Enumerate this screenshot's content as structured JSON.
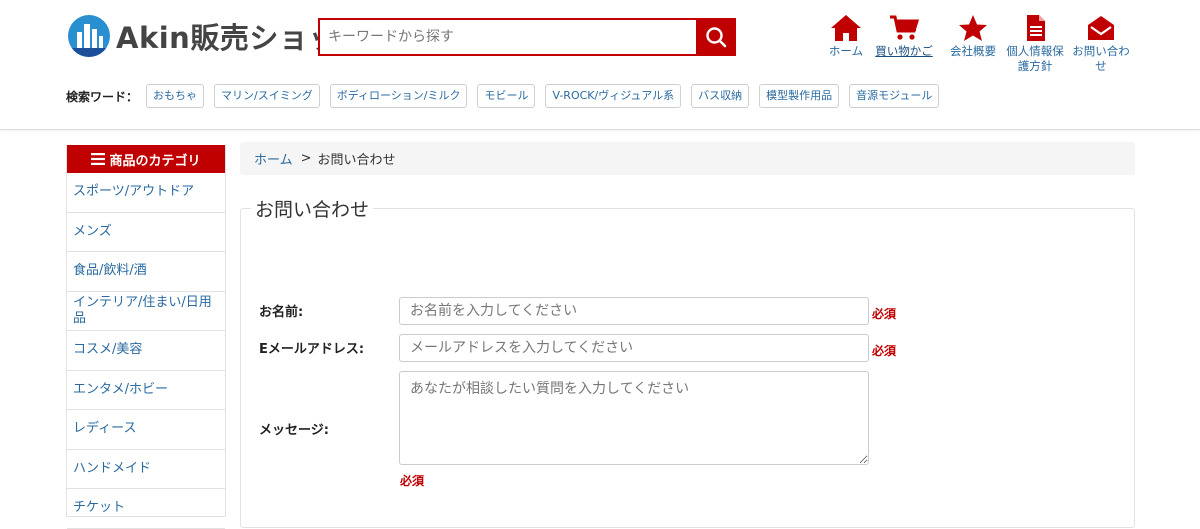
{
  "header": {
    "logo_text": "Akin販売ショッ",
    "search_placeholder": "キーワードから探す"
  },
  "nav": {
    "home": "ホーム",
    "cart": "買い物かご",
    "company": "会社概要",
    "privacy_line1": "個人情報保",
    "privacy_line2": "護方針",
    "contact_line1": "お問い合わ",
    "contact_line2": "せ"
  },
  "keywords": {
    "title": "検索ワード：",
    "tags": [
      "おもちゃ",
      "マリン/スイミング",
      "ボディローション/ミルク",
      "モビール",
      "V-ROCK/ヴィジュアル系",
      "バス収納",
      "模型製作用品",
      "音源モジュール"
    ]
  },
  "sidebar": {
    "title": "商品のカテゴリ",
    "items": [
      "スポーツ/アウトドア",
      "メンズ",
      "食品/飲料/酒",
      "インテリア/住まい/日用品",
      "コスメ/美容",
      "エンタメ/ホビー",
      "レディース",
      "ハンドメイド",
      "チケット"
    ]
  },
  "breadcrumb": {
    "home": "ホーム",
    "separator": ">",
    "current": "お問い合わせ"
  },
  "form": {
    "title": "お問い合わせ",
    "name_label": "お名前:",
    "name_placeholder": "お名前を入力してください",
    "email_label": "Eメールアドレス:",
    "email_placeholder": "メールアドレスを入力してください",
    "message_label": "メッセージ:",
    "message_placeholder": "あなたが相談したい質問を入力してください",
    "required": "必須"
  },
  "colors": {
    "accent": "#c00000",
    "link": "#2a6aa0"
  }
}
